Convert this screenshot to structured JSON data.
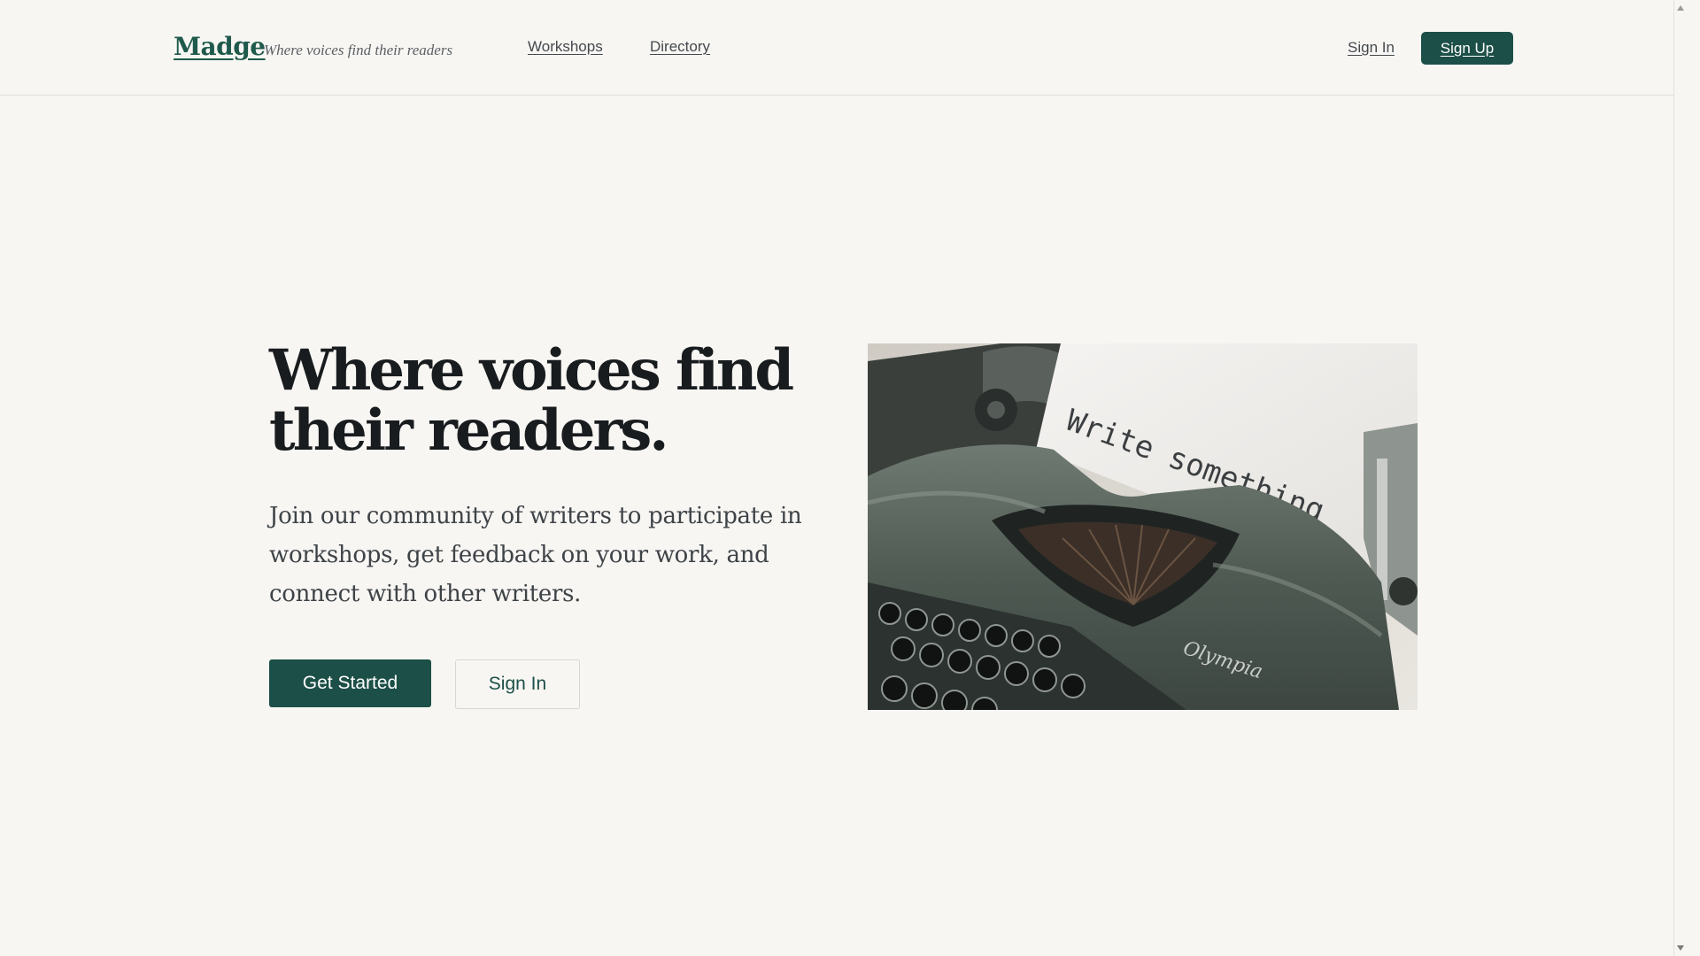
{
  "header": {
    "logo": "Madge",
    "tagline": "Where voices find their readers",
    "nav": {
      "workshops": "Workshops",
      "directory": "Directory"
    },
    "sign_in": "Sign In",
    "sign_up": "Sign Up"
  },
  "hero": {
    "title_line1": "Where voices find",
    "title_line2": "their readers.",
    "subtitle": "Join our community of writers to participate in workshops, get feedback on your work, and connect with other writers.",
    "primary_button": "Get Started",
    "secondary_button": "Sign In",
    "image": {
      "paper_text": "Write something",
      "brand_mark": "Olympia"
    }
  },
  "colors": {
    "background": "#f8f6f3",
    "accent": "#1c4f47",
    "logo": "#1f5a4c",
    "text": "#181c1e"
  }
}
